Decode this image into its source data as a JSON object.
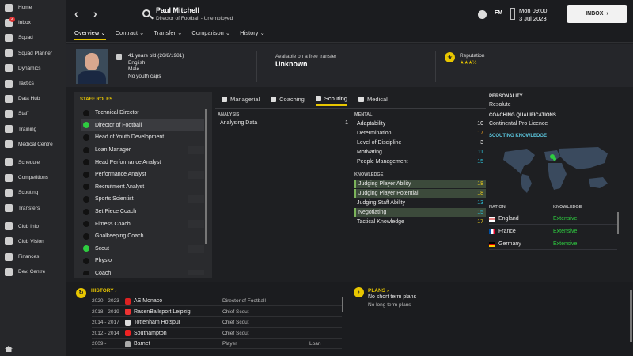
{
  "sidebar": {
    "items": [
      {
        "label": "Home",
        "icon": "home-icon"
      },
      {
        "label": "Inbox",
        "icon": "inbox-icon",
        "badge": "2"
      },
      {
        "label": "Squad",
        "icon": "squad-icon"
      },
      {
        "label": "Squad Planner",
        "icon": "squad-planner-icon"
      },
      {
        "label": "Dynamics",
        "icon": "dynamics-icon"
      },
      {
        "label": "Tactics",
        "icon": "tactics-icon"
      },
      {
        "label": "Data Hub",
        "icon": "data-hub-icon"
      },
      {
        "label": "Staff",
        "icon": "staff-icon"
      },
      {
        "label": "Training",
        "icon": "training-icon"
      },
      {
        "label": "Medical Centre",
        "icon": "medical-icon"
      },
      {
        "label": "Schedule",
        "icon": "schedule-icon"
      },
      {
        "label": "Competitions",
        "icon": "trophy-icon"
      },
      {
        "label": "Scouting",
        "icon": "scouting-icon"
      },
      {
        "label": "Transfers",
        "icon": "transfers-icon"
      },
      {
        "label": "Club Info",
        "icon": "club-info-icon"
      },
      {
        "label": "Club Vision",
        "icon": "club-vision-icon"
      },
      {
        "label": "Finances",
        "icon": "finances-icon"
      },
      {
        "label": "Dev. Centre",
        "icon": "dev-centre-icon"
      }
    ]
  },
  "header": {
    "name": "Paul Mitchell",
    "subtitle": "Director of Football - Unemployed",
    "back_glyph": "‹",
    "forward_glyph": "›",
    "fm_logo": "FM",
    "date_day": "Mon 09:00",
    "date_full": "3 Jul 2023",
    "inbox_label": "INBOX",
    "inbox_arrow": "›",
    "tabs": [
      "Overview ⌄",
      "Contract ⌄",
      "Transfer ⌄",
      "Comparison ⌄",
      "History ⌄"
    ]
  },
  "profile": {
    "age_dob": "41 years old (26/8/1981)",
    "nationality": "English",
    "gender": "Male",
    "caps": "No youth caps",
    "availability_label": "Available on a free transfer",
    "availability_value": "Unknown",
    "reputation_label": "Reputation",
    "reputation_stars": "★★★½",
    "reputation_stars_value": 3.5
  },
  "staff_roles": {
    "title": "STAFF ROLES",
    "roles": [
      {
        "name": "Technical Director",
        "active": false
      },
      {
        "name": "Director of Football",
        "active": true
      },
      {
        "name": "Head of Youth Development",
        "active": false
      },
      {
        "name": "Loan Manager",
        "active": false
      },
      {
        "name": "Head Performance Analyst",
        "active": false
      },
      {
        "name": "Performance Analyst",
        "active": false
      },
      {
        "name": "Recruitment Analyst",
        "active": false
      },
      {
        "name": "Sports Scientist",
        "active": false
      },
      {
        "name": "Set Piece Coach",
        "active": false
      },
      {
        "name": "Fitness Coach",
        "active": false
      },
      {
        "name": "Goalkeeping Coach",
        "active": false
      },
      {
        "name": "Scout",
        "active": true
      },
      {
        "name": "Physio",
        "active": false
      },
      {
        "name": "Coach",
        "active": false
      }
    ]
  },
  "attribute_tabs": [
    "Managerial",
    "Coaching",
    "Scouting",
    "Medical"
  ],
  "analysis": {
    "title": "ANALYSIS",
    "rows": [
      {
        "name": "Analysing Data",
        "value": "1"
      }
    ]
  },
  "mental": {
    "title": "MENTAL",
    "rows": [
      {
        "name": "Adaptability",
        "value": "10",
        "color": "white",
        "hl": false
      },
      {
        "name": "Determination",
        "value": "17",
        "color": "orange",
        "hl": false
      },
      {
        "name": "Level of Discipline",
        "value": "3",
        "color": "white",
        "hl": false
      },
      {
        "name": "Motivating",
        "value": "11",
        "color": "cyan",
        "hl": false
      },
      {
        "name": "People Management",
        "value": "15",
        "color": "cyan",
        "hl": false
      }
    ]
  },
  "knowledge": {
    "title": "KNOWLEDGE",
    "rows": [
      {
        "name": "Judging Player Ability",
        "value": "18",
        "color": "yellow",
        "hl": true
      },
      {
        "name": "Judging Player Potential",
        "value": "18",
        "color": "yellow",
        "hl": true
      },
      {
        "name": "Judging Staff Ability",
        "value": "13",
        "color": "cyan",
        "hl": false
      },
      {
        "name": "Negotiating",
        "value": "15",
        "color": "cyan",
        "hl": true
      },
      {
        "name": "Tactical Knowledge",
        "value": "17",
        "color": "yellow",
        "hl": false
      }
    ]
  },
  "right": {
    "personality_h": "PERSONALITY",
    "personality_v": "Resolute",
    "coaching_h": "COACHING QUALIFICATIONS",
    "coaching_v": "Continental Pro Licence",
    "scouting_h": "SCOUTING KNOWLEDGE",
    "nation_h": "NATION",
    "knowledge_h": "KNOWLEDGE",
    "nations": [
      {
        "name": "England",
        "level": "Extensive"
      },
      {
        "name": "France",
        "level": "Extensive"
      },
      {
        "name": "Germany",
        "level": "Extensive"
      }
    ]
  },
  "history": {
    "link": "HISTORY ›",
    "rows": [
      {
        "years": "2020 - 2023",
        "club": "AS Monaco",
        "role": "Director of Football",
        "extra": "",
        "badge": "#d22"
      },
      {
        "years": "2018 - 2019",
        "club": "RasenBallsport Leipzig",
        "role": "Chief Scout",
        "extra": "",
        "badge": "#e33"
      },
      {
        "years": "2014 - 2017",
        "club": "Tottenham Hotspur",
        "role": "Chief Scout",
        "extra": "",
        "badge": "#ddd"
      },
      {
        "years": "2012 - 2014",
        "club": "Southampton",
        "role": "Chief Scout",
        "extra": "",
        "badge": "#e22"
      },
      {
        "years": "2009 -",
        "club": "Barnet",
        "role": "Player",
        "extra": "Loan",
        "badge": "#aaa"
      }
    ]
  },
  "plans": {
    "link": "PLANS ›",
    "short": "No short term plans",
    "long": "No long term plans"
  },
  "icons": {
    "history": "↻",
    "plans": "›",
    "reputation": "★"
  }
}
